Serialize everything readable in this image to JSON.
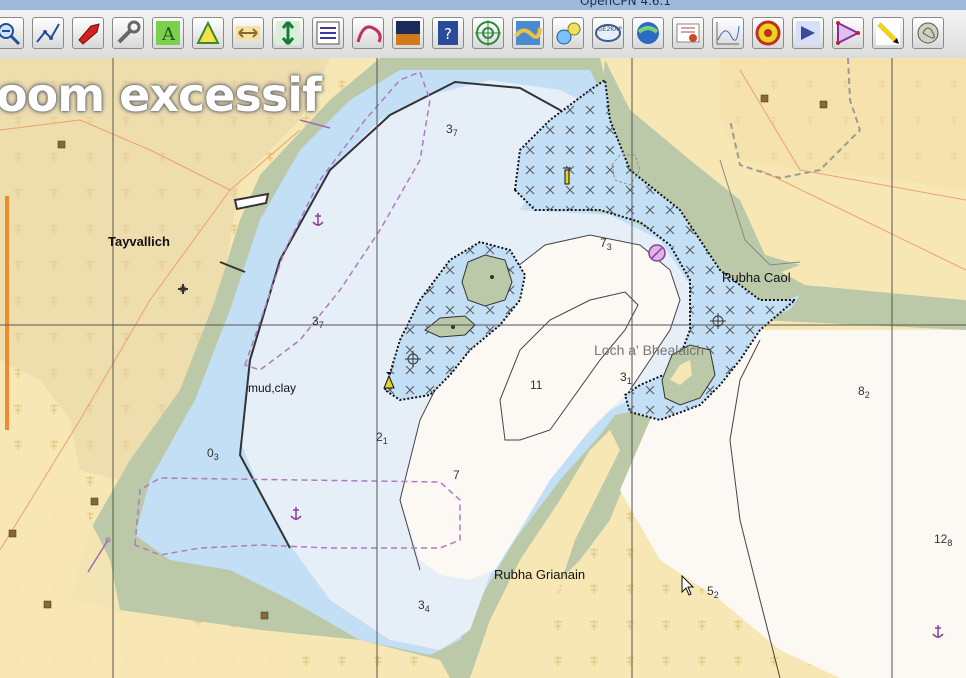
{
  "window": {
    "title": "OpenCPN 4.6.1"
  },
  "toolbar": {
    "buttons": [
      {
        "icon": "zoom-out-icon",
        "label": "Zoom Out"
      },
      {
        "icon": "route-icon",
        "label": "Create Route"
      },
      {
        "icon": "autofollow-boat-icon",
        "label": "Auto Follow"
      },
      {
        "icon": "settings-wrench-icon",
        "label": "Options"
      },
      {
        "icon": "text-toggle-icon",
        "label": "Show ENC Text"
      },
      {
        "icon": "track-icon",
        "label": "Enable Tracking"
      },
      {
        "icon": "scale-left-right-icon",
        "label": "Shift chart"
      },
      {
        "icon": "tide-arrows-icon",
        "label": "Show Tides"
      },
      {
        "icon": "route-manager-icon",
        "label": "Route Manager"
      },
      {
        "icon": "track-line-icon",
        "label": "Track"
      },
      {
        "icon": "night-mode-icon",
        "label": "Color Scheme"
      },
      {
        "icon": "help-book-icon",
        "label": "About"
      },
      {
        "icon": "target-icon",
        "label": "Target"
      },
      {
        "icon": "grib-icon",
        "label": "GRIB"
      },
      {
        "icon": "ais-icon",
        "label": "AIS"
      },
      {
        "icon": "gebco-icon",
        "label": "GE2KAP"
      },
      {
        "icon": "globe-icon",
        "label": "Google Earth"
      },
      {
        "icon": "weather-fax-icon",
        "label": "Weather Fax"
      },
      {
        "icon": "graph-icon",
        "label": "Dashboard"
      },
      {
        "icon": "climatology-icon",
        "label": "Climatology"
      },
      {
        "icon": "watchdog-icon",
        "label": "Watchdog"
      },
      {
        "icon": "export-route-icon",
        "label": "Route"
      },
      {
        "icon": "pencil-icon",
        "label": "Draw"
      },
      {
        "icon": "wind-icon",
        "label": "Wind"
      }
    ]
  },
  "chart": {
    "overzoom_text": "oom excessif",
    "places": [
      {
        "name": "Tayvallich"
      },
      {
        "name": "Rubha Caol"
      },
      {
        "name": "Loch a' Bhealaich"
      },
      {
        "name": "Rubha Grianain"
      }
    ],
    "seabed_note": "mud,clay",
    "soundings": [
      {
        "m": "3",
        "d": "7"
      },
      {
        "m": "3",
        "d": "7"
      },
      {
        "m": "7",
        "d": "3"
      },
      {
        "m": "0",
        "d": "3"
      },
      {
        "m": "2",
        "d": "1"
      },
      {
        "m": "3",
        "d": "1"
      },
      {
        "m": "11",
        "d": ""
      },
      {
        "m": "7",
        "d": ""
      },
      {
        "m": "3",
        "d": "4"
      },
      {
        "m": "8",
        "d": "2"
      },
      {
        "m": "5",
        "d": "2"
      },
      {
        "m": "12",
        "d": "8"
      }
    ]
  },
  "colors": {
    "land": "#f7e7b4",
    "drying": "#bcc9a9",
    "shallow": "#c3dff5",
    "medium": "#e6eef8",
    "deep": "#fcf8f4"
  }
}
